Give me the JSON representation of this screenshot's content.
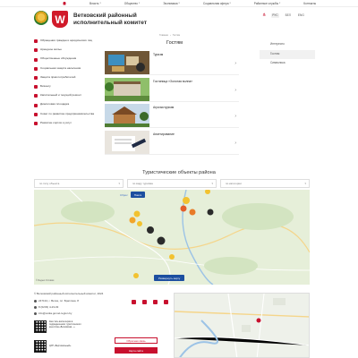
{
  "topnav": {
    "items": [
      "Власть",
      "Общество",
      "Экономика",
      "Социальная сфера",
      "Районные службы",
      "Контакты"
    ]
  },
  "header": {
    "title_line1": "Ветковский районный",
    "title_line2": "исполнительный комитет",
    "city_crest_letter": "W",
    "languages": [
      "РУС",
      "БЕЛ",
      "ENG"
    ]
  },
  "leftnav": {
    "items": [
      "Обращения граждан и юридических лиц",
      "Арендное жилье",
      "Общественные обсуждения",
      "Социальная защита населения",
      "Защита прав потребителей",
      "Бизнесу",
      "Капитальный и текущий ремонт",
      "Диалоговая площадка",
      "Совет по развитию предпринимательства",
      "Развитие сортов и услуг"
    ]
  },
  "breadcrumb": [
    "Главная",
    "Гостям"
  ],
  "page_title": "Гостям",
  "cards": [
    {
      "label": "Туризм"
    },
    {
      "label": "Гостиница «Золотая волна»"
    },
    {
      "label": "Агроэкотуризм"
    },
    {
      "label": "Анкетирование"
    }
  ],
  "rightnav": {
    "items": [
      "Интересно",
      "Гостям",
      "Символика"
    ],
    "active_index": 1
  },
  "map_section": {
    "title": "Туристические объекты района",
    "filters": [
      "по типу объекта",
      "по виду туризма",
      "по категории"
    ],
    "reset_label": "Сброс",
    "search_label": "Поиск",
    "expand_label": "Развернуть карту",
    "credit": "© Яндекс Условия"
  },
  "footer": {
    "copyright": "© Ветковский районный исполнительный комитет, 2024",
    "address": "247134, г. Ветка, пл. Братская, 8",
    "phone": "8 (0233) 4-23-03",
    "email": "info@vetka.gomel-region.by",
    "qr1_text": "Как стать волонтером в подразделениях туристического агентства «Ветковская...»",
    "qr2_text": "ЦУР «Вертикальный»",
    "contact_label": "Обратная связь",
    "site_map_label": "Карта сайта"
  },
  "colors": {
    "accent": "#c8102e",
    "button_blue": "#1c4fa0",
    "map_land": "#e6efd9"
  }
}
